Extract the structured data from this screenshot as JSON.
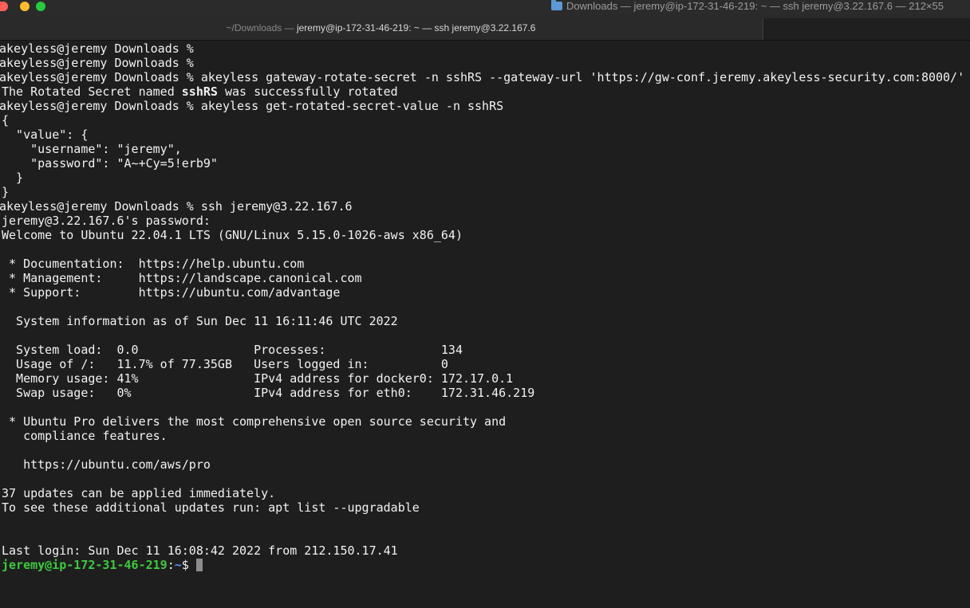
{
  "window": {
    "title": "Downloads — jeremy@ip-172-31-46-219: ~ — ssh jeremy@3.22.167.6 — 212×55"
  },
  "tab": {
    "prefix": "~/Downloads — ",
    "highlight": "jeremy@ip-172-31-46-219: ~ — ssh jeremy@3.22.167.6"
  },
  "colors": {
    "background": "#1e1e1e",
    "text": "#f2f2f2",
    "prompt_user": "#3ec93e",
    "prompt_path": "#5c8eff",
    "close": "#ff5f57",
    "minimize": "#febc2e",
    "zoom": "#28c840"
  },
  "icons": [
    "close-button",
    "minimize-button",
    "zoom-button",
    "folder-icon",
    "cursor"
  ],
  "terminal": {
    "lines": [
      "akeyless@jeremy Downloads %",
      "akeyless@jeremy Downloads %",
      "akeyless@jeremy Downloads % akeyless gateway-rotate-secret -n sshRS --gateway-url 'https://gw-conf.jeremy.akeyless-security.com:8000/'",
      "The Rotated Secret named ",
      "sshRS",
      " was successfully rotated",
      "akeyless@jeremy Downloads % akeyless get-rotated-secret-value -n sshRS",
      "{",
      "  \"value\": {",
      "    \"username\": \"jeremy\",",
      "    \"password\": \"A~+Cy=5!erb9\"",
      "  }",
      "}",
      "akeyless@jeremy Downloads % ssh jeremy@3.22.167.6",
      "jeremy@3.22.167.6's password:",
      "Welcome to Ubuntu 22.04.1 LTS (GNU/Linux 5.15.0-1026-aws x86_64)",
      "",
      " * Documentation:  https://help.ubuntu.com",
      " * Management:     https://landscape.canonical.com",
      " * Support:        https://ubuntu.com/advantage",
      "",
      "  System information as of Sun Dec 11 16:11:46 UTC 2022",
      "",
      "  System load:  0.0                Processes:                134",
      "  Usage of /:   11.7% of 77.35GB   Users logged in:          0",
      "  Memory usage: 41%                IPv4 address for docker0: 172.17.0.1",
      "  Swap usage:   0%                 IPv4 address for eth0:    172.31.46.219",
      "",
      " * Ubuntu Pro delivers the most comprehensive open source security and",
      "   compliance features.",
      "",
      "   https://ubuntu.com/aws/pro",
      "",
      "37 updates can be applied immediately.",
      "To see these additional updates run: apt list --upgradable",
      "",
      "",
      "Last login: Sun Dec 11 16:08:42 2022 from 212.150.17.41",
      "jeremy@ip-172-31-46-219",
      ":",
      "~",
      "$ "
    ]
  }
}
